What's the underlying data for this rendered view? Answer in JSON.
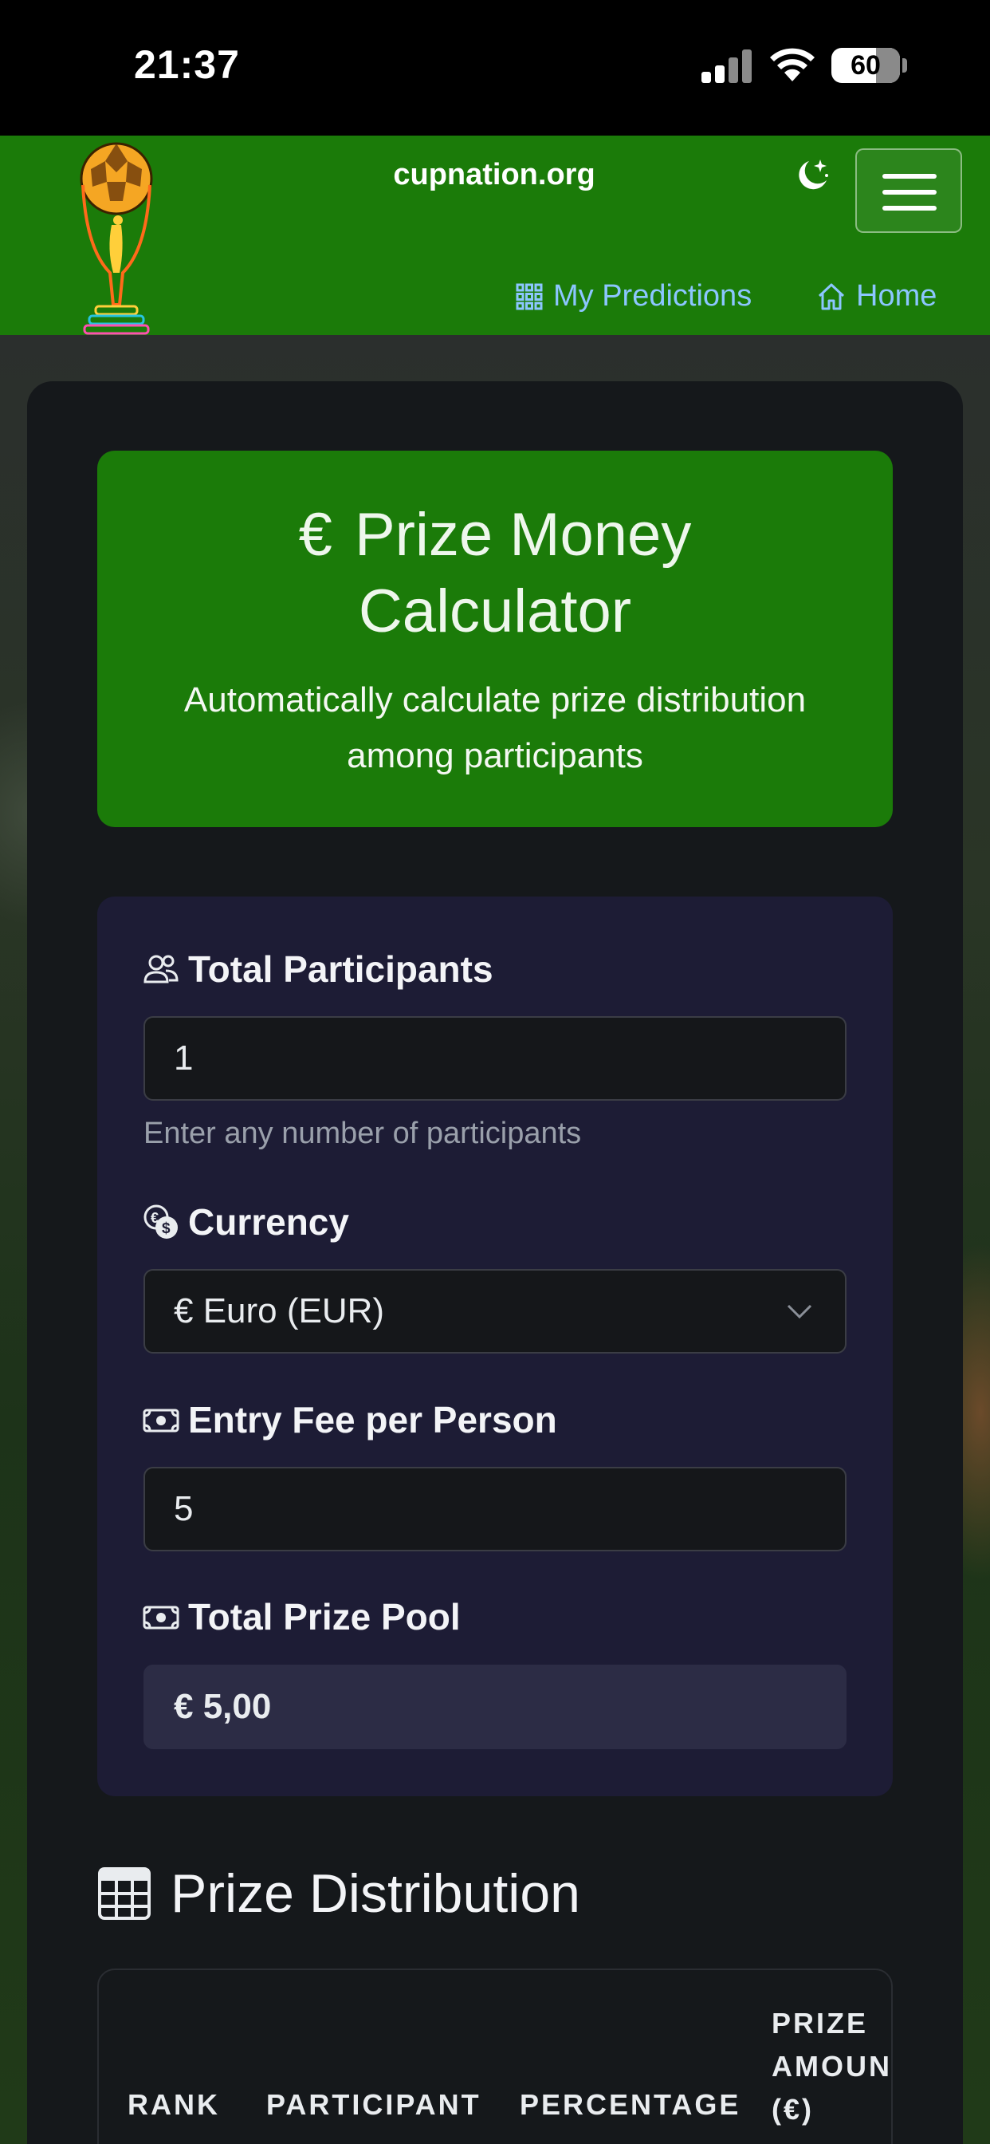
{
  "status_bar": {
    "time": "21:37",
    "battery": "60"
  },
  "navbar": {
    "brand": "cupnation.org",
    "links": [
      {
        "label": "My Predictions",
        "icon": "grid-icon"
      },
      {
        "label": "Home",
        "icon": "house-icon"
      }
    ]
  },
  "hero": {
    "currency_symbol": "€",
    "title_line1": "Prize Money",
    "title_line2": "Calculator",
    "subtitle": "Automatically calculate prize distribution among participants"
  },
  "form": {
    "participants_label": "Total Participants",
    "participants_value": "1",
    "participants_help": "Enter any number of participants",
    "currency_label": "Currency",
    "currency_value": "€ Euro (EUR)",
    "entry_fee_label": "Entry Fee per Person",
    "entry_fee_value": "5",
    "prize_pool_label": "Total Prize Pool",
    "prize_pool_value": "€ 5,00"
  },
  "distribution": {
    "title": "Prize Distribution",
    "columns": [
      "RANK",
      "PARTICIPANT",
      "PERCENTAGE",
      "PRIZE",
      "AMOUNT",
      "(€)"
    ]
  },
  "colors": {
    "brand_green": "#1b7b09",
    "card": "#15181b",
    "form_card": "#1d1c35",
    "link": "#8cc6ff"
  }
}
